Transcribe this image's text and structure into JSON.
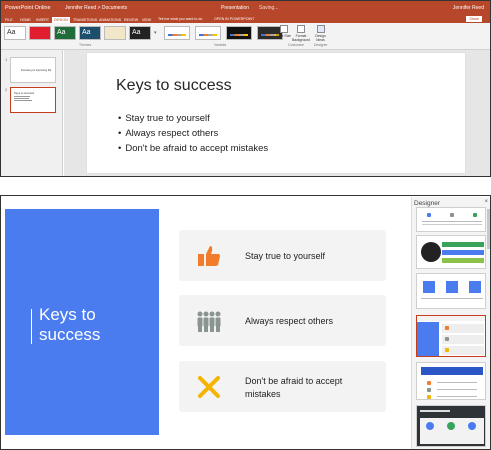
{
  "app": {
    "name": "PowerPoint Online",
    "breadcrumb": "Jennifer Reed > Documents",
    "doc_title": "Presentation",
    "status": "Saving...",
    "user": "Jennifer Reed"
  },
  "tabs": [
    "FILE",
    "HOME",
    "INSERT",
    "DESIGN",
    "TRANSITIONS",
    "ANIMATIONS",
    "REVIEW",
    "VIEW"
  ],
  "active_tab": "DESIGN",
  "tell_me": "Tell me what you want to do",
  "open_in": "OPEN IN POWERPOINT",
  "share": "Share",
  "ribbon": {
    "themes_group": "Themes",
    "variants_group": "Variants",
    "customize_group": "Customize",
    "designer_group": "Designer",
    "slide_size": "Slide Size",
    "format_background": "Format Background",
    "design_ideas": "Design Ideas",
    "theme_letters": "Aa"
  },
  "thumbnails": [
    {
      "num": "1",
      "text": "Focusing on improving life"
    },
    {
      "num": "2",
      "text": "Keys to success"
    }
  ],
  "slide": {
    "title": "Keys to success",
    "bullets": [
      "Stay true to yourself",
      "Always respect others",
      "Don't be afraid to accept mistakes"
    ]
  },
  "design": {
    "title": "Keys to success",
    "items": [
      {
        "text": "Stay true to yourself",
        "icon": "thumbs-up-icon"
      },
      {
        "text": "Always respect others",
        "icon": "people-icon"
      },
      {
        "text": "Don't be afraid to accept mistakes",
        "icon": "x-mark-icon"
      }
    ]
  },
  "designer": {
    "title": "Designer",
    "close": "×",
    "selected_index": 3
  },
  "colors": {
    "accent_red": "#b7472a",
    "blue": "#4a7cf0",
    "orange": "#f07c2c",
    "gold": "#f4b400",
    "gray_icon": "#8a9590"
  }
}
